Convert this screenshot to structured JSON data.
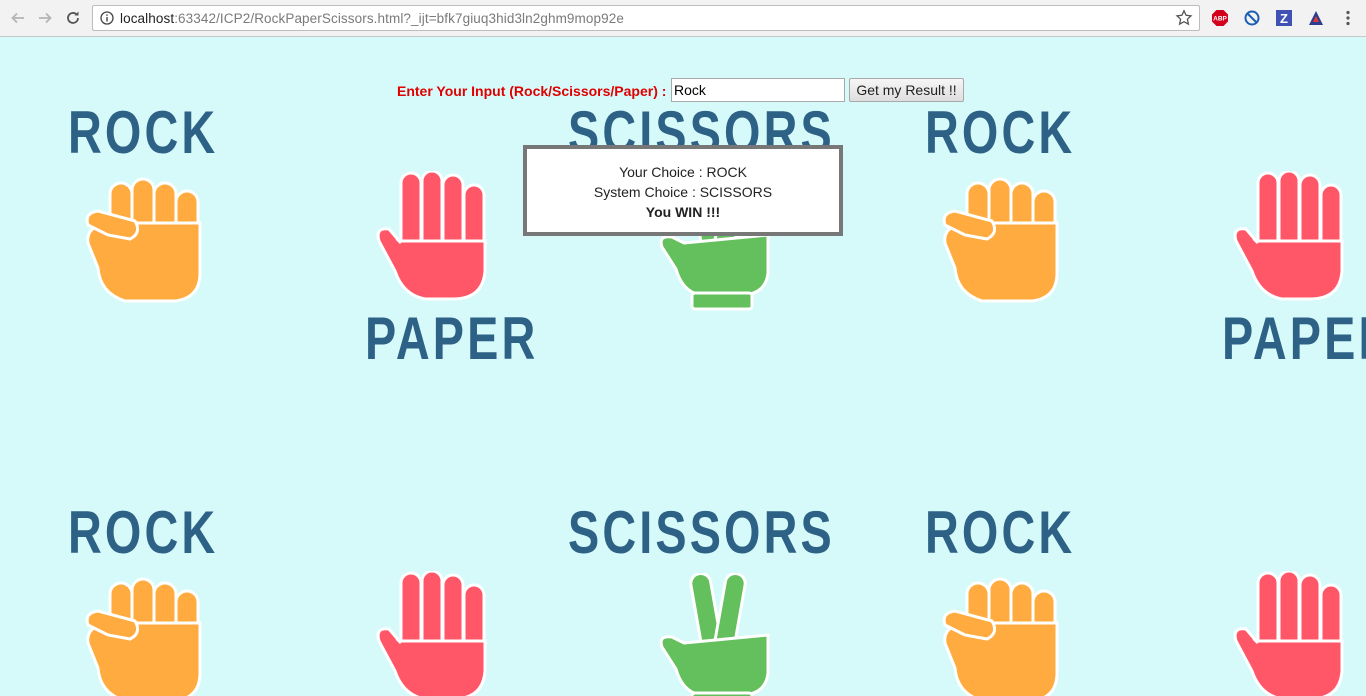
{
  "browser": {
    "url_host": "localhost",
    "url_rest": ":63342/ICP2/RockPaperScissors.html?_ijt=bfk7giuq3hid3ln2ghm9mop92e",
    "extensions": [
      {
        "name": "adblock-plus",
        "label": "ABP",
        "color": "#d3001b"
      },
      {
        "name": "block",
        "color": "#1a5fb4"
      },
      {
        "name": "z-extension",
        "label": "Z",
        "color": "#3f51b5"
      },
      {
        "name": "misc-extension",
        "color": "#2c3e8f"
      }
    ]
  },
  "background": {
    "color": "#d6fafa",
    "word_color": "#2e6186",
    "rock_color": "#ffab3f",
    "paper_color": "#ff5767",
    "scissors_color": "#64bf5d",
    "words": {
      "rock": "ROCK",
      "paper": "PAPER",
      "scissors": "SCISSORS"
    }
  },
  "form": {
    "label": "Enter Your Input (Rock/Scissors/Paper) :",
    "input_value": "Rock",
    "button_label": "Get my Result !!"
  },
  "result": {
    "your_choice": "Your Choice : ROCK",
    "system_choice": "System Choice : SCISSORS",
    "outcome": "You WIN !!!"
  }
}
